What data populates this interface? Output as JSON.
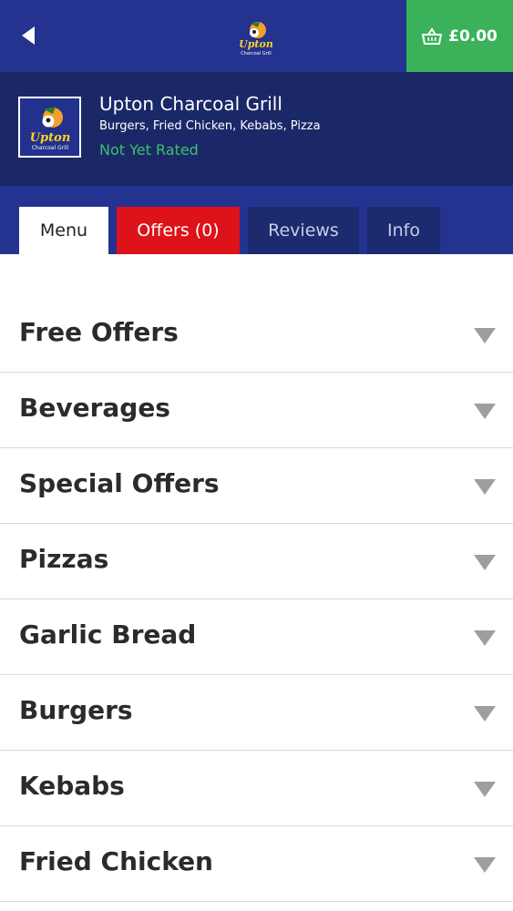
{
  "header": {
    "back_icon": "back-arrow-icon",
    "logo_icon": "upton-charcoal-grill-logo",
    "basket_icon": "basket-icon",
    "basket_total": "£0.00"
  },
  "store": {
    "name": "Upton Charcoal Grill",
    "cuisines": "Burgers, Fried Chicken, Kebabs, Pizza",
    "rating": "Not Yet Rated",
    "logo_text_1": "Upton",
    "logo_text_2": "Charcoal Grill"
  },
  "tabs": [
    {
      "label": "Menu"
    },
    {
      "label": "Offers (0)"
    },
    {
      "label": "Reviews"
    },
    {
      "label": "Info"
    }
  ],
  "categories": [
    {
      "label": "Free Offers"
    },
    {
      "label": "Beverages"
    },
    {
      "label": "Special Offers"
    },
    {
      "label": "Pizzas"
    },
    {
      "label": "Garlic Bread"
    },
    {
      "label": "Burgers"
    },
    {
      "label": "Kebabs"
    },
    {
      "label": "Fried Chicken"
    }
  ],
  "colors": {
    "header_blue": "#243290",
    "info_navy": "#1b2868",
    "basket_green": "#3bb25a",
    "offers_red": "#de1219",
    "rating_green": "#3cc167"
  }
}
